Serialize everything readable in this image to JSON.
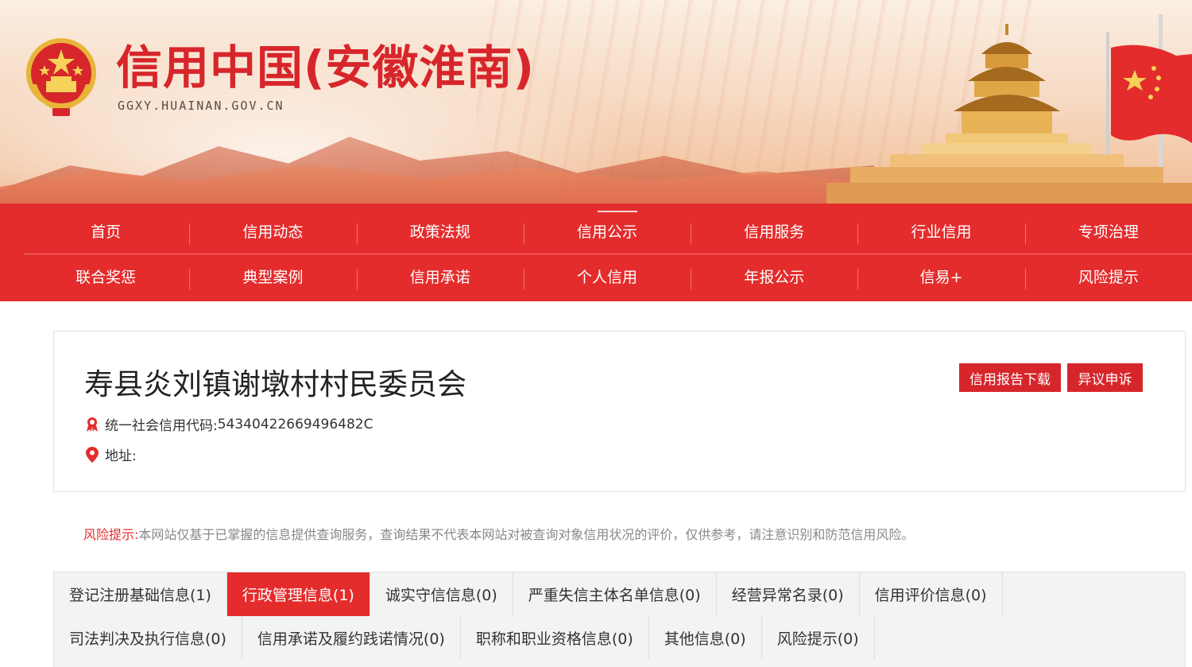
{
  "header": {
    "site_title": "信用中国(安徽淮南)",
    "site_domain": "GGXY.HUAINAN.GOV.CN",
    "emblem_icon": "national-emblem-icon",
    "temple_image": "temple-of-heaven-illustration"
  },
  "nav": {
    "row1": [
      "首页",
      "信用动态",
      "政策法规",
      "信用公示",
      "信用服务",
      "行业信用",
      "专项治理"
    ],
    "row2": [
      "联合奖惩",
      "典型案例",
      "信用承诺",
      "个人信用",
      "年报公示",
      "信易+",
      "风险提示"
    ],
    "active": "信用公示",
    "colors": {
      "background": "#e42c2c",
      "text": "#ffffff"
    }
  },
  "entity": {
    "name": "寿县炎刘镇谢墩村村民委员会",
    "credit_code_label": "统一社会信用代码:",
    "credit_code_value": "54340422669496482C",
    "address_label": "地址:",
    "address_value": "",
    "credit_code_icon": "award-ribbon-icon",
    "address_icon": "location-pin-icon",
    "buttons": {
      "report_download": "信用报告下载",
      "appeal": "异议申诉"
    }
  },
  "risk_notice": {
    "label": "风险提示:",
    "text": "本网站仅基于已掌握的信息提供查询服务，查询结果不代表本网站对被查询对象信用状况的评价，仅供参考，请注意识别和防范信用风险。"
  },
  "tabs": {
    "row1": [
      "登记注册基础信息(1)",
      "行政管理信息(1)",
      "诚实守信信息(0)",
      "严重失信主体名单信息(0)",
      "经营异常名录(0)",
      "信用评价信息(0)"
    ],
    "row2": [
      "司法判决及执行信息(0)",
      "信用承诺及履约践诺情况(0)",
      "职称和职业资格信息(0)",
      "其他信息(0)",
      "风险提示(0)"
    ],
    "active": "行政管理信息(1)"
  },
  "colors": {
    "accent_red": "#e42c2c",
    "title_red": "#d7262b",
    "text_dark": "#222222",
    "text_muted": "#888888"
  }
}
